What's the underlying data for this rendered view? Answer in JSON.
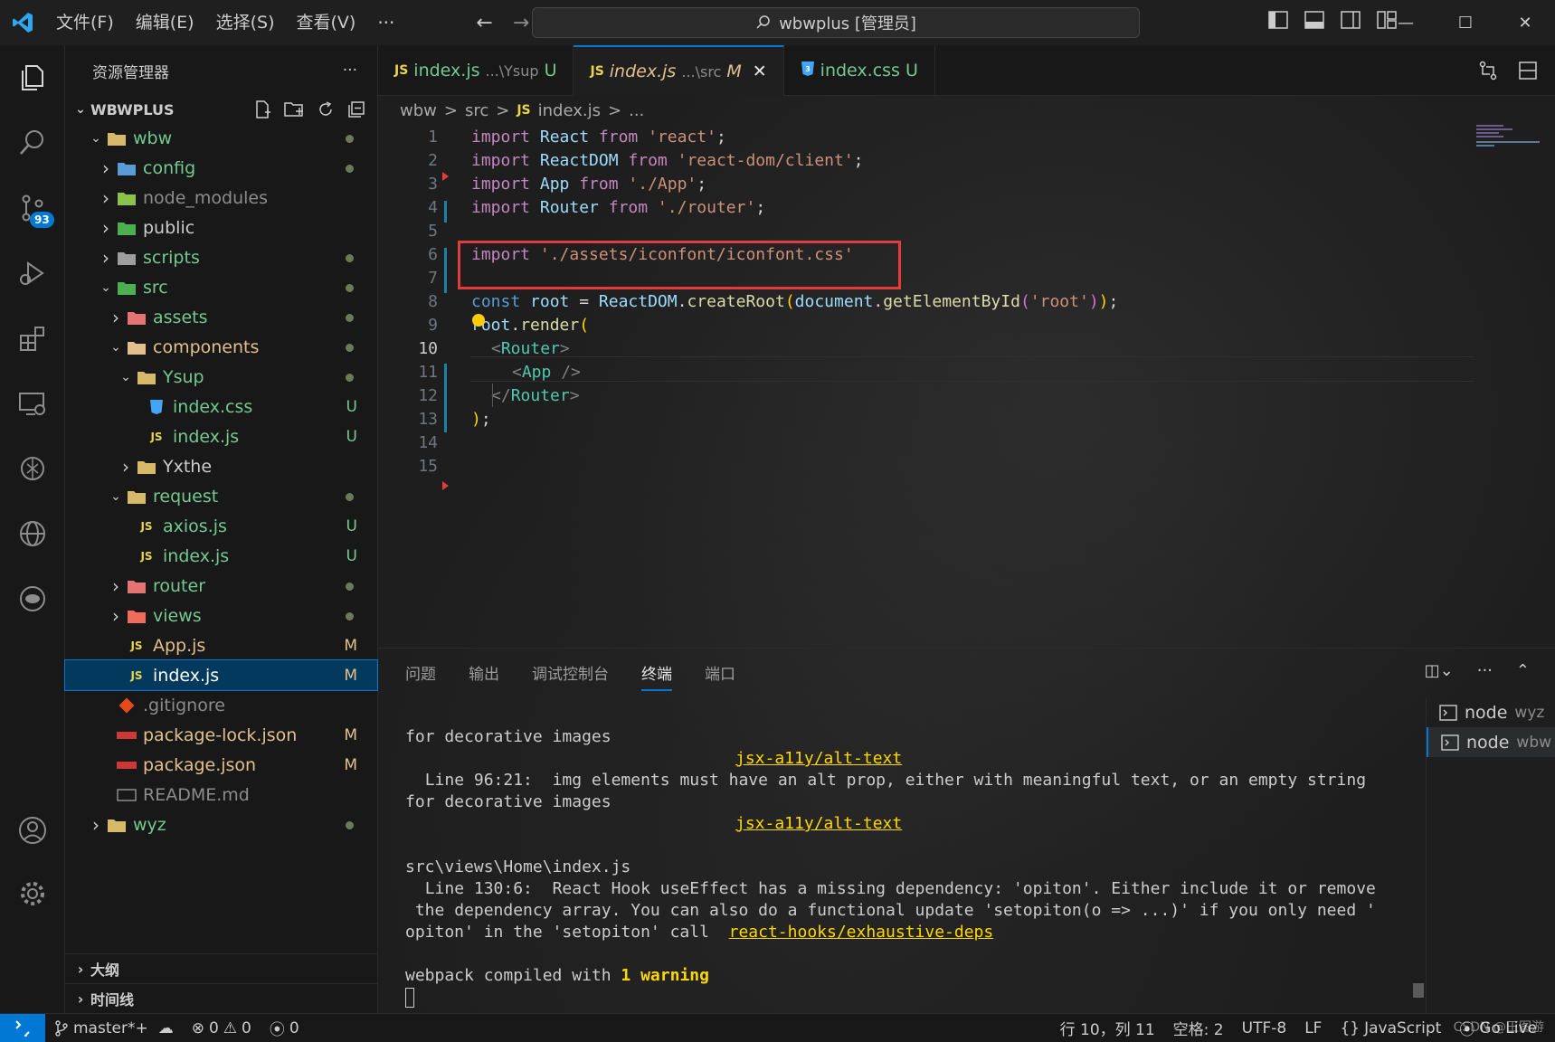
{
  "menu": [
    "文件(F)",
    "编辑(E)",
    "选择(S)",
    "查看(V)"
  ],
  "menu_more": "···",
  "search": {
    "text": "wbwplus [管理员]"
  },
  "activity": {
    "scm_badge": "93"
  },
  "sidebar": {
    "title": "资源管理器",
    "more": "···",
    "root": "WBWPLUS",
    "tree": [
      {
        "label": "wbw",
        "status": "dot"
      },
      {
        "label": "config",
        "status": "dot"
      },
      {
        "label": "node_modules",
        "status": ""
      },
      {
        "label": "public",
        "status": ""
      },
      {
        "label": "scripts",
        "status": "dot"
      },
      {
        "label": "src",
        "status": "dot"
      },
      {
        "label": "assets",
        "status": "dot"
      },
      {
        "label": "components",
        "status": "dot"
      },
      {
        "label": "Ysup",
        "status": "dot"
      },
      {
        "label": "index.css",
        "status": "U"
      },
      {
        "label": "index.js",
        "status": "U"
      },
      {
        "label": "Yxthe",
        "status": ""
      },
      {
        "label": "request",
        "status": "dot"
      },
      {
        "label": "axios.js",
        "status": "U"
      },
      {
        "label": "index.js",
        "status": "U"
      },
      {
        "label": "router",
        "status": "dot"
      },
      {
        "label": "views",
        "status": "dot"
      },
      {
        "label": "App.js",
        "status": "M"
      },
      {
        "label": "index.js",
        "status": "M"
      },
      {
        "label": ".gitignore",
        "status": ""
      },
      {
        "label": "package-lock.json",
        "status": "M"
      },
      {
        "label": "package.json",
        "status": "M"
      },
      {
        "label": "README.md",
        "status": ""
      },
      {
        "label": "wyz",
        "status": "dot"
      }
    ],
    "outline": "大纲",
    "timeline": "时间线"
  },
  "tabs": [
    {
      "icon": "JS",
      "name": "index.js",
      "path": "...\\Ysup",
      "status": "U"
    },
    {
      "icon": "JS",
      "name": "index.js",
      "path": "...\\src",
      "status": "M",
      "close": "✕"
    },
    {
      "icon": "CSS",
      "name": "index.css",
      "path": "",
      "status": "U"
    }
  ],
  "breadcrumb": [
    "wbw",
    ">",
    "src",
    ">",
    "JS",
    "index.js",
    ">",
    "..."
  ],
  "code": {
    "line_numbers": [
      "1",
      "2",
      "3",
      "4",
      "5",
      "6",
      "7",
      "8",
      "9",
      "10",
      "11",
      "12",
      "13",
      "14",
      "15"
    ],
    "l1": [
      "import",
      " React ",
      "from",
      " 'react'",
      ";"
    ],
    "l2": [
      "import",
      " ReactDOM ",
      "from",
      " 'react-dom/client'",
      ";"
    ],
    "l3": [
      "import",
      " App ",
      "from",
      " './App'",
      ";"
    ],
    "l4": [
      "import",
      " Router ",
      "from",
      " './router'",
      ";"
    ],
    "l6": [
      "import",
      " './assets/iconfont/iconfont.css'"
    ],
    "l8": [
      "const",
      " root ",
      "= ",
      "ReactDOM",
      ".",
      "createRoot",
      "(",
      "document",
      ".",
      "getElementById",
      "(",
      "'root'",
      ")",
      ")",
      ";"
    ],
    "l9": [
      "root",
      ".",
      "render",
      "("
    ],
    "l10": [
      "<",
      "Router",
      ">"
    ],
    "l11": [
      "<",
      "App",
      " />"
    ],
    "l12": [
      "</",
      "Router",
      ">"
    ],
    "l13": [
      ")",
      ";"
    ]
  },
  "panel": {
    "tabs": [
      "问题",
      "输出",
      "调试控制台",
      "终端",
      "端口"
    ],
    "active_tab": "终端",
    "terminal": {
      "t1": "for decorative images",
      "t2_link": "jsx-a11y/alt-text",
      "t3": "  Line 96:21:  img elements must have an alt prop, either with meaningful text, or an empty string",
      "t4": "for decorative images",
      "t5_link": "jsx-a11y/alt-text",
      "t6": "src\\views\\Home\\index.js",
      "t7": "  Line 130:6:  React Hook useEffect has a missing dependency: 'opiton'. Either include it or remove",
      "t8": " the dependency array. You can also do a functional update 'setopiton(o => ...)' if you only need '",
      "t9": "opiton' in the 'setopiton' call  ",
      "t9_link": "react-hooks/exhaustive-deps",
      "t10_a": "webpack compiled with ",
      "t10_b": "1 warning"
    },
    "terminals": [
      {
        "name": "node",
        "sub": "wyz"
      },
      {
        "name": "node",
        "sub": "wbw"
      }
    ]
  },
  "status": {
    "branch": "master*+",
    "errors": "0",
    "warnings": "0",
    "ports": "0",
    "position": "行 10，列 11",
    "spaces": "空格: 2",
    "encoding": "UTF-8",
    "eol": "LF",
    "language": "JavaScript",
    "golive": "Go Live",
    "watermark": "CSDN @王图游"
  },
  "colors": {
    "accent": "#0078d4",
    "highlight_box": "#e23c3c",
    "untracked": "#73c991",
    "modified": "#e2c08d"
  }
}
